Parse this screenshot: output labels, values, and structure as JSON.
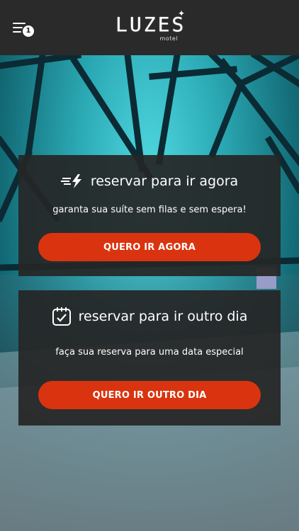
{
  "header": {
    "logo_text": "LUZES",
    "logo_sub": "motel",
    "menu_badge": "1"
  },
  "cards": [
    {
      "icon": "flash-icon",
      "title": "reservar para ir agora",
      "subtitle": "garanta sua suíte sem filas e sem espera!",
      "button_label": "QUERO IR AGORA"
    },
    {
      "icon": "calendar-check-icon",
      "title": "reservar para ir outro dia",
      "subtitle": "faça sua reserva para uma data especial",
      "button_label": "QUERO IR OUTRO DIA"
    }
  ],
  "colors": {
    "header_bg": "#2a2a2a",
    "accent": "#d9340f",
    "card_bg": "#262626"
  }
}
